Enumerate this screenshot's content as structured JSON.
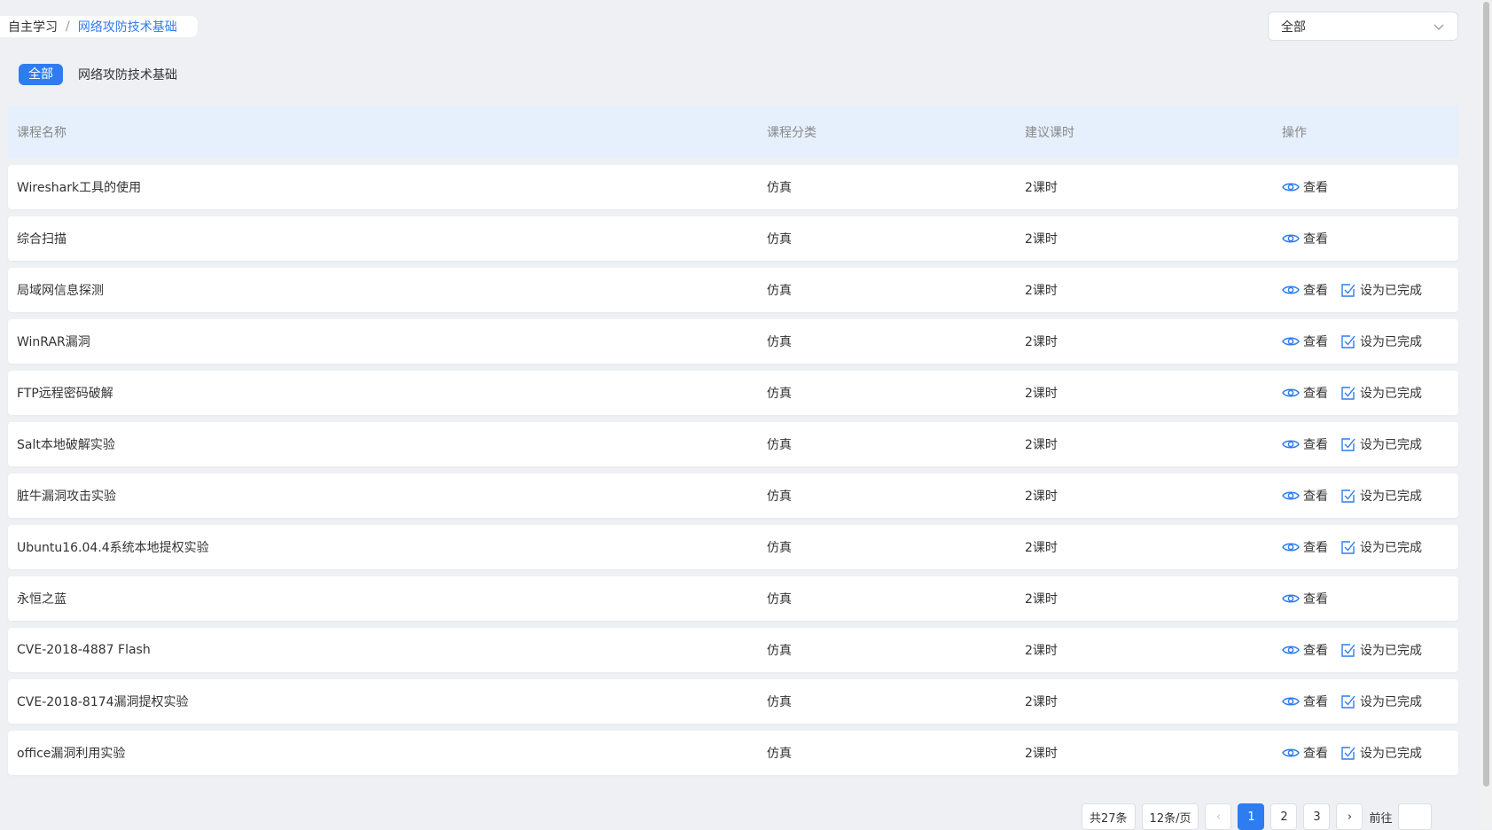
{
  "breadcrumb": {
    "root": "自主学习",
    "separator": "/",
    "current": "网络攻防技术基础"
  },
  "filter": {
    "selected": "全部"
  },
  "tags": {
    "active": "全部",
    "other": "网络攻防技术基础"
  },
  "table": {
    "headers": {
      "name": "课程名称",
      "category": "课程分类",
      "hours": "建议课时",
      "ops": "操作"
    },
    "view_label": "查看",
    "complete_label": "设为已完成",
    "rows": [
      {
        "name": "Wireshark工具的使用",
        "category": "仿真",
        "hours": "2课时",
        "can_complete": false
      },
      {
        "name": "综合扫描",
        "category": "仿真",
        "hours": "2课时",
        "can_complete": false
      },
      {
        "name": "局域网信息探测",
        "category": "仿真",
        "hours": "2课时",
        "can_complete": true
      },
      {
        "name": "WinRAR漏洞",
        "category": "仿真",
        "hours": "2课时",
        "can_complete": true
      },
      {
        "name": "FTP远程密码破解",
        "category": "仿真",
        "hours": "2课时",
        "can_complete": true
      },
      {
        "name": "Salt本地破解实验",
        "category": "仿真",
        "hours": "2课时",
        "can_complete": true
      },
      {
        "name": "脏牛漏洞攻击实验",
        "category": "仿真",
        "hours": "2课时",
        "can_complete": true
      },
      {
        "name": "Ubuntu16.04.4系统本地提权实验",
        "category": "仿真",
        "hours": "2课时",
        "can_complete": true
      },
      {
        "name": "永恒之蓝",
        "category": "仿真",
        "hours": "2课时",
        "can_complete": false
      },
      {
        "name": "CVE-2018-4887 Flash",
        "category": "仿真",
        "hours": "2课时",
        "can_complete": true
      },
      {
        "name": "CVE-2018-8174漏洞提权实验",
        "category": "仿真",
        "hours": "2课时",
        "can_complete": true
      },
      {
        "name": "office漏洞利用实验",
        "category": "仿真",
        "hours": "2课时",
        "can_complete": true
      }
    ]
  },
  "pagination": {
    "total": "共27条",
    "page_size": "12条/页",
    "prev": "‹",
    "pages": [
      "1",
      "2",
      "3"
    ],
    "current_page": "1",
    "next": "›",
    "goto_label": "前往"
  },
  "colors": {
    "accent": "#2f7cf0",
    "header_bg": "#e6f0fd",
    "page_bg": "#eef0f4"
  }
}
